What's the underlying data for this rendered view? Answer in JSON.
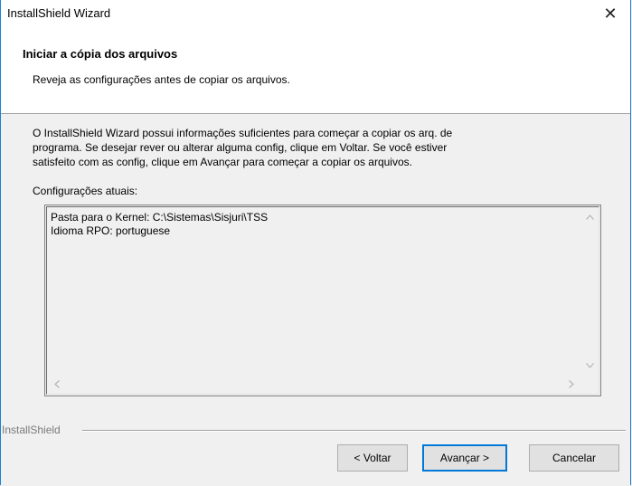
{
  "window": {
    "title": "InstallShield Wizard",
    "close_glyph": "✕"
  },
  "header": {
    "title": "Iniciar a cópia dos arquivos",
    "subtitle": "Reveja as configurações antes de copiar os arquivos."
  },
  "body": {
    "lines": [
      "O InstallShield Wizard possui informações suficientes para começar a copiar os arq. de",
      "programa.  Se desejar rever ou alterar alguma config, clique em Voltar.  Se você estiver",
      "satisfeito com as config, clique em Avançar para começar a copiar os arquivos."
    ],
    "settings_label": "Configurações atuais:"
  },
  "settings": {
    "items": [
      "Pasta para o Kernel: C:\\Sistemas\\Sisjuri\\TSS",
      "Idioma RPO: portuguese"
    ]
  },
  "footer": {
    "brand": "InstallShield"
  },
  "buttons": {
    "back": "< Voltar",
    "next": "Avançar >",
    "cancel": "Cancelar"
  }
}
